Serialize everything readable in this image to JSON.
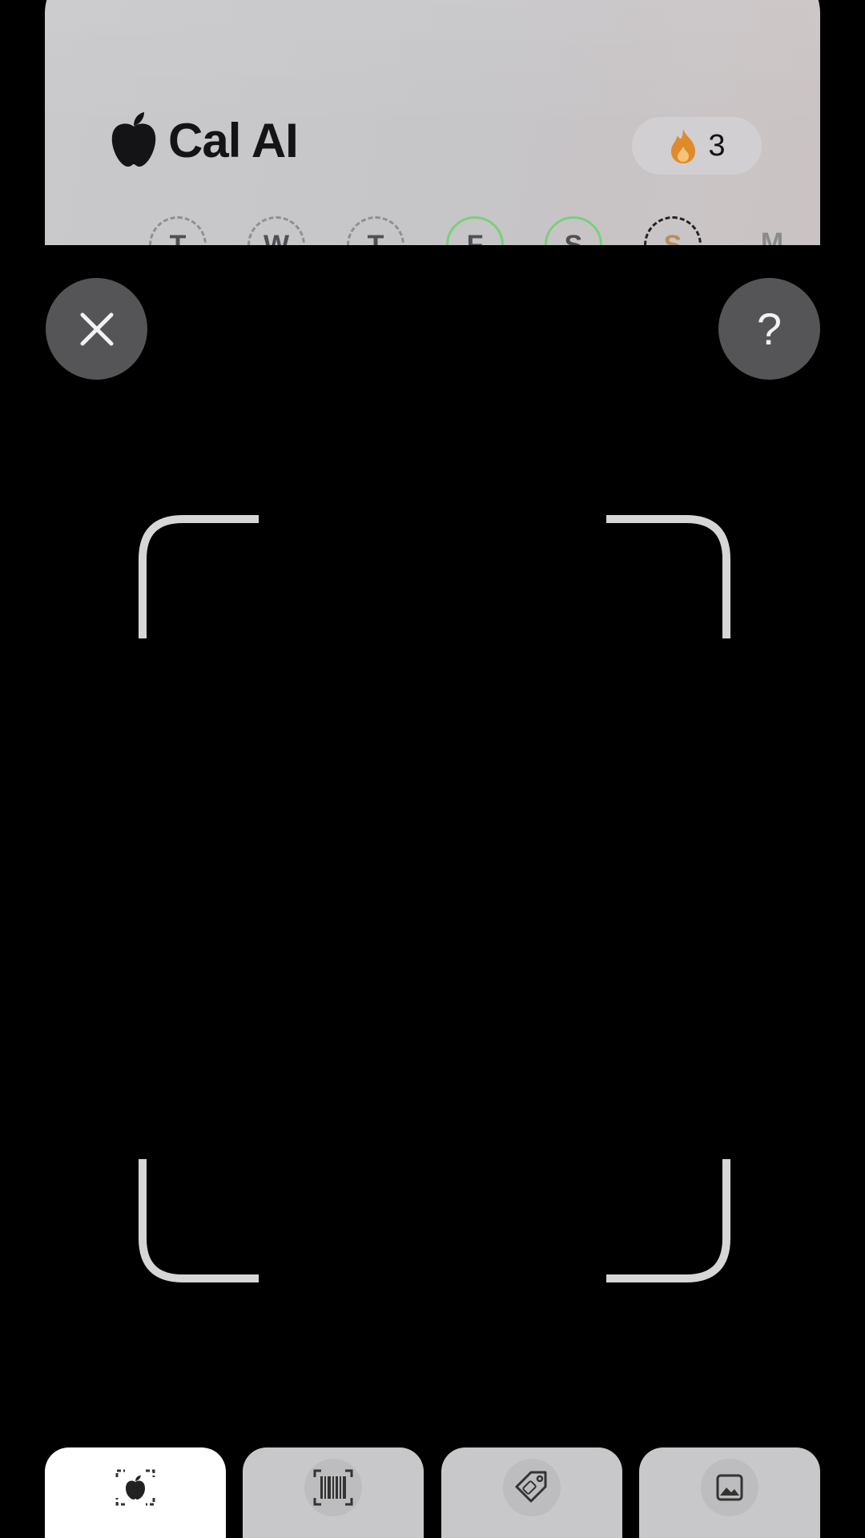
{
  "header": {
    "app_name": "Cal AI",
    "logo_icon": "apple-logo-icon",
    "streak": {
      "icon": "flame-icon",
      "count": "3"
    }
  },
  "week_days": [
    {
      "label": "T",
      "state": "pending"
    },
    {
      "label": "W",
      "state": "pending"
    },
    {
      "label": "T",
      "state": "pending"
    },
    {
      "label": "F",
      "state": "complete"
    },
    {
      "label": "S",
      "state": "complete"
    },
    {
      "label": "S",
      "state": "today"
    },
    {
      "label": "M",
      "state": "future"
    }
  ],
  "controls": {
    "close_icon": "close-icon",
    "help_label": "?"
  },
  "scanner": {
    "frame_icon": "viewfinder-corners"
  },
  "modes": [
    {
      "name": "scan-food",
      "icon": "scan-food-icon",
      "active": true
    },
    {
      "name": "barcode",
      "icon": "barcode-icon",
      "active": false
    },
    {
      "name": "food-label",
      "icon": "food-label-icon",
      "active": false
    },
    {
      "name": "library",
      "icon": "image-icon",
      "active": false
    }
  ],
  "colors": {
    "accent_green": "#7ccf7c",
    "flame": "#e08a2c",
    "card_bg": "#c9c9cb"
  }
}
